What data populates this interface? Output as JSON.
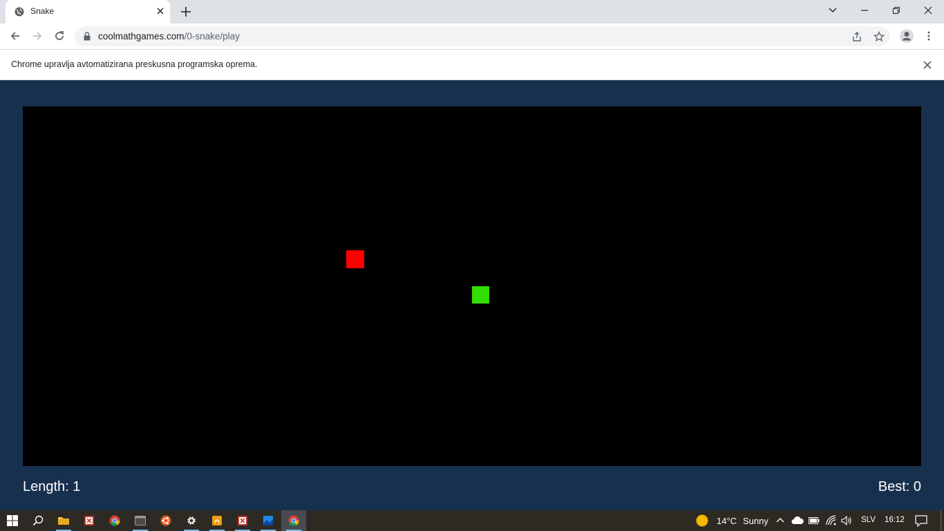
{
  "browser": {
    "tab_title": "Snake",
    "url_domain": "coolmathgames.com",
    "url_path": "/0-snake/play",
    "infobar_text": "Chrome upravlja avtomatizirana preskusna programska oprema."
  },
  "game": {
    "length_label": "Length: 1",
    "best_label": "Best: 0",
    "food_color": "#ff0000",
    "snake_color": "#33dd00",
    "board_color": "#000000",
    "background_color": "#17304d"
  },
  "taskbar": {
    "weather": "14°C",
    "weather_desc": "Sunny",
    "language": "SLV",
    "time": "16:12",
    "apps": [
      "start-icon",
      "search-icon",
      "file-explorer-icon",
      "app-icon",
      "chrome-icon",
      "terminal-icon",
      "ubuntu-icon",
      "settings-icon",
      "app-orange-icon",
      "app-icon-2",
      "photos-icon",
      "chrome-active-icon"
    ]
  }
}
